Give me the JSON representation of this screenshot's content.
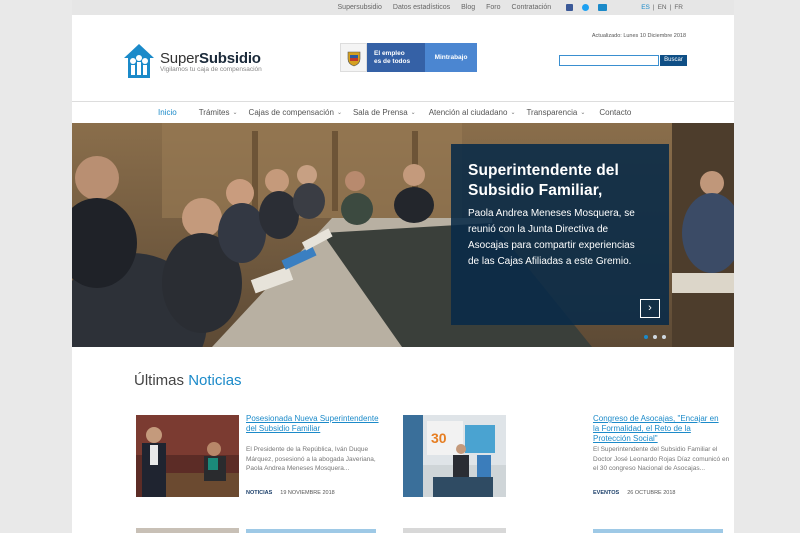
{
  "topbar": {
    "links": [
      "Supersubsidio",
      "Datos estadísticos",
      "Blog",
      "Foro",
      "Contratación"
    ],
    "social_icons": [
      "facebook-icon",
      "twitter-icon",
      "youtube-icon"
    ],
    "languages": [
      "ES",
      "EN",
      "FR"
    ],
    "active_language": "ES"
  },
  "header": {
    "logo_light": "Super",
    "logo_bold": "Subsidio",
    "tagline": "Vigilamos tu caja de compensación",
    "gov_banner": {
      "line1": "El empleo",
      "line2": "es de todos",
      "ministry": "Mintrabajo"
    },
    "updated": "Actualizado: Lunes 10 Diciembre 2018",
    "search": {
      "placeholder": "",
      "button": "Buscar"
    }
  },
  "nav": [
    {
      "label": "Inicio",
      "dropdown": false,
      "active": true
    },
    {
      "label": "Trámites",
      "dropdown": true
    },
    {
      "label": "Cajas de compensación",
      "dropdown": true
    },
    {
      "label": "Sala de Prensa",
      "dropdown": true
    },
    {
      "label": "Atención al ciudadano",
      "dropdown": true
    },
    {
      "label": "Transparencia",
      "dropdown": true
    },
    {
      "label": "Contacto",
      "dropdown": false
    }
  ],
  "hero": {
    "title_line1": "Superintendente del",
    "title_line2": "Subsidio Familiar,",
    "body_line1": "Paola Andrea Meneses Mosquera, se",
    "body_line2": "reunió con la Junta Directiva de",
    "body_line3": "Asocajas para compartir experiencias",
    "body_line4": "de las Cajas Afiliadas a este Gremio.",
    "slides": 3,
    "active_slide": 1
  },
  "news": {
    "title_plain": "Últimas",
    "title_accent": "Noticias",
    "items": [
      {
        "title": "Posesionada Nueva Superintendente del Subsidio Familiar",
        "excerpt": "El Presidente de la República, Iván Duque Márquez, posesionó a la abogada Javeriana, Paola Andrea Meneses Mosquera...",
        "category": "NOTICIAS",
        "date": "19 NOVIEMBRE 2018"
      },
      {
        "title": "Congreso de Asocajas, \"Encajar en la Formalidad, el Reto de la Protección Social\"",
        "excerpt": "El Superintendente del Subsidio Familiar el Doctor José Leonardo Rojas Díaz comunicó en el 30 congreso Nacional de Asocajas...",
        "category": "EVENTOS",
        "date": "26 OCTUBRE 2018"
      }
    ]
  },
  "colors": {
    "accent": "#1b8ac9",
    "dark_blue": "#0f4f86",
    "caption_bg": "#082a48"
  }
}
